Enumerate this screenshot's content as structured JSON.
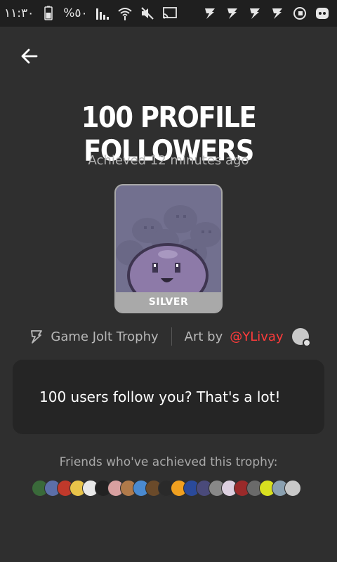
{
  "status_bar": {
    "time": "١١:٣٠",
    "battery_percent": "%٥٠",
    "left_icons": [
      "battery-icon",
      "signal-icon",
      "wifi-icon",
      "mute-icon",
      "cast-icon"
    ],
    "right_icons": [
      "gamejolt-notification-icon",
      "gamejolt-notification-icon",
      "gamejolt-notification-icon",
      "gamejolt-notification-icon",
      "recorder-icon",
      "game-controller-icon"
    ]
  },
  "header": {
    "back_icon": "arrow-left-icon"
  },
  "trophy": {
    "title": "100 PROFILE FOLLOWERS",
    "achieved_text": "Achieved 12 minutes ago",
    "tier": "SILVER",
    "source_label": "Game Jolt Trophy",
    "art_by_label": "Art by",
    "artist": "@YLivay",
    "description": "100 users follow you? That's a lot!"
  },
  "friends": {
    "label": "Friends who've achieved this trophy:",
    "avatar_colors": [
      "#3a6a3a",
      "#5c6fa8",
      "#c0392b",
      "#e8c44a",
      "#e8e8e8",
      "#222222",
      "#d8a0a0",
      "#b07a4a",
      "#4a8ad0",
      "#6a4a2a",
      "#2a2a2a",
      "#f0a020",
      "#2a4a9a",
      "#4a4a7a",
      "#888888",
      "#ddd0e0",
      "#9a2a2a",
      "#6a6a6a",
      "#d8e020",
      "#8aa0b0",
      "#c8c8c8"
    ]
  },
  "colors": {
    "background": "#2f2f2f",
    "card": "#252525",
    "accent_link": "#ff3b3b",
    "tier_silver": "#a9a9a9"
  }
}
